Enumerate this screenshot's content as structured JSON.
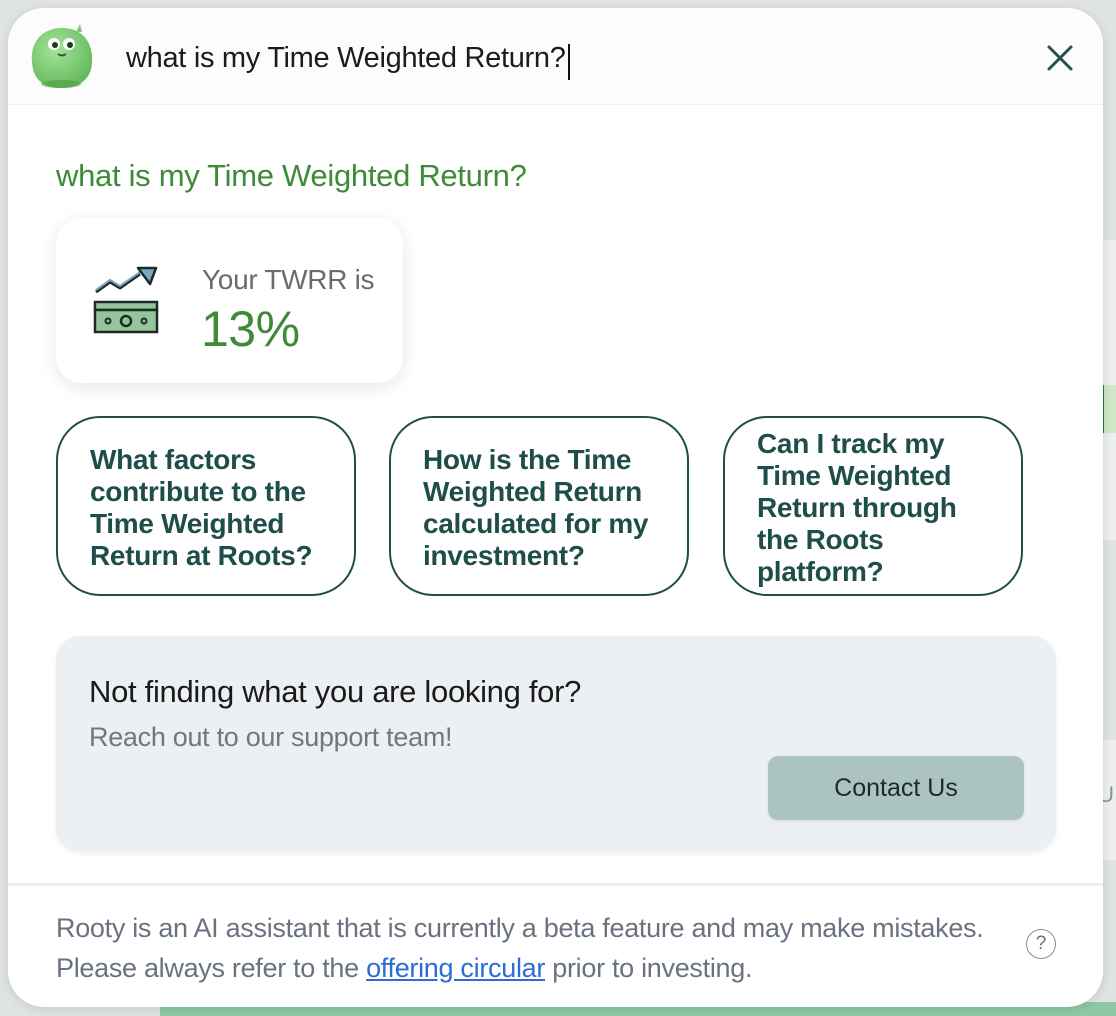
{
  "search": {
    "value": "what is my Time Weighted Return?"
  },
  "answer": {
    "question": "what is my Time Weighted Return?",
    "result_label": "Your TWRR is",
    "result_value": "13%"
  },
  "suggestions": [
    {
      "label": "What factors contribute to the Time Weighted Return at Roots?"
    },
    {
      "label": "How is the Time Weighted Return calculated for my investment?"
    },
    {
      "label": "Can I track my Time Weighted Return through the Roots platform?"
    }
  ],
  "support": {
    "title": "Not finding what you are looking for?",
    "subtitle": "Reach out to our support team!",
    "button": "Contact Us"
  },
  "footer": {
    "disclaimer_before": "Rooty is an AI assistant that is currently a beta feature and may make mistakes. Please always refer to the ",
    "link_text": "offering circular",
    "disclaimer_after": " prior to investing.",
    "help_glyph": "?"
  },
  "background": {
    "peek_letter": "U"
  },
  "colors": {
    "accent_green": "#3e8a37",
    "suggestion_text": "#1f4d4a",
    "contact_button": "#acc4bf",
    "support_card": "#edf0f3",
    "link": "#2b6cd6"
  },
  "icons": {
    "mascot": "green-blob-mascot",
    "close": "close-x-icon",
    "result": "money-trend-up-icon",
    "help": "question-circle-icon"
  }
}
